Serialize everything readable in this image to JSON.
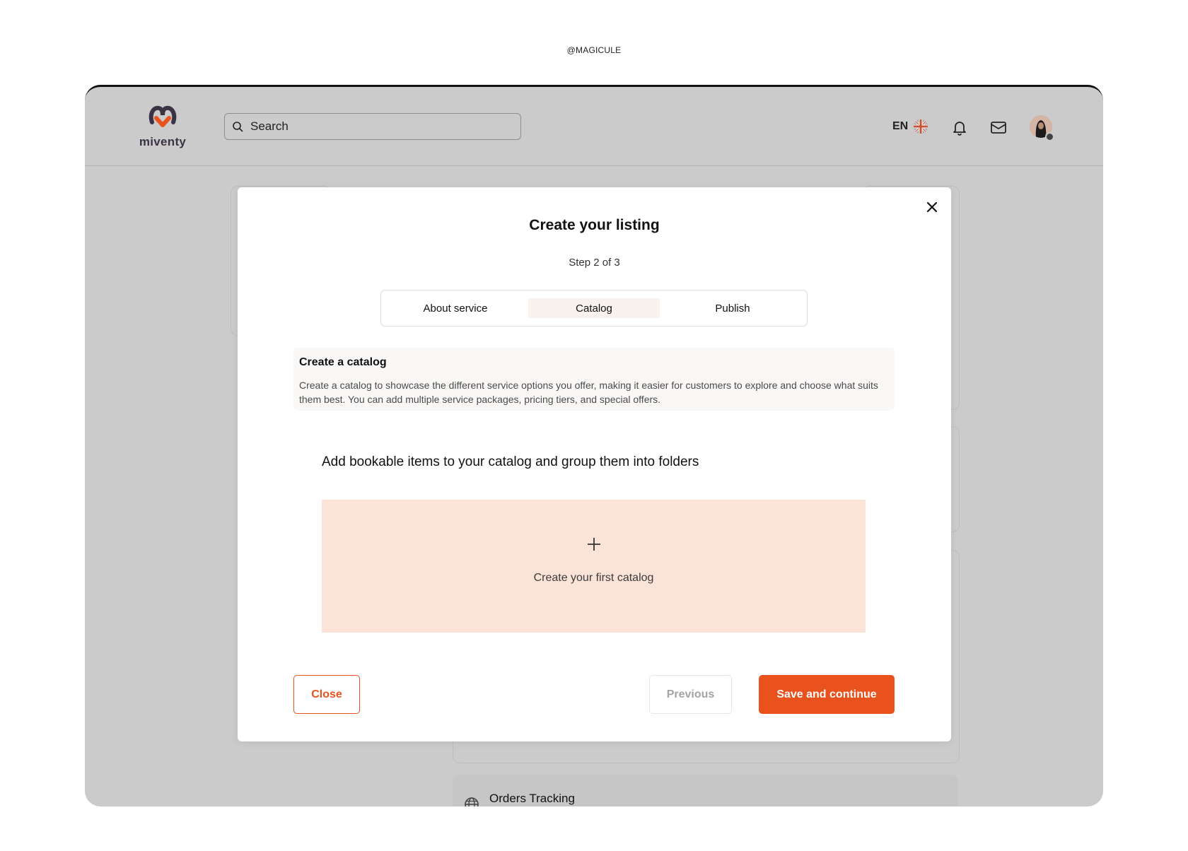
{
  "watermark": "@MAGICULE",
  "header": {
    "logo_text": "miventy",
    "search_placeholder": "Search",
    "language": "EN"
  },
  "background": {
    "orders_label": "Orders Tracking"
  },
  "modal": {
    "title": "Create your listing",
    "step": "Step 2 of 3",
    "tabs": [
      {
        "label": "About service",
        "active": false
      },
      {
        "label": "Catalog",
        "active": true
      },
      {
        "label": "Publish",
        "active": false
      }
    ],
    "info": {
      "title": "Create a catalog",
      "body": "Create a catalog to showcase the different service options you offer, making it easier for customers to explore and choose what suits them best. You can add multiple service packages, pricing tiers, and special offers."
    },
    "subheading": "Add bookable items to your catalog and group them into folders",
    "create_label": "Create your first catalog",
    "buttons": {
      "close": "Close",
      "previous": "Previous",
      "save": "Save and continue"
    }
  },
  "colors": {
    "accent": "#e9521d",
    "create_box": "#fce3d8",
    "overlay": "#cbcbcb"
  }
}
